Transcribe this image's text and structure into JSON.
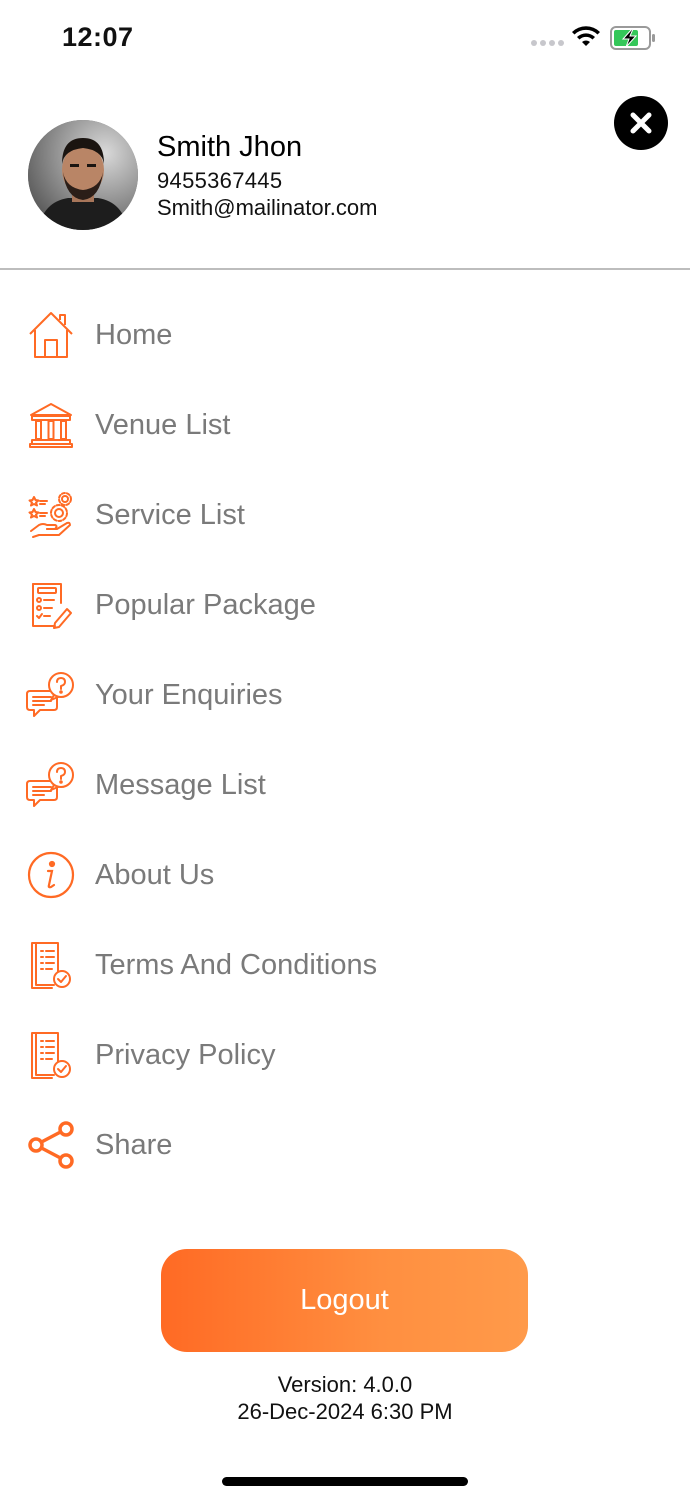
{
  "status_bar": {
    "time": "12:07"
  },
  "profile": {
    "name": "Smith Jhon",
    "phone": "9455367445",
    "email": "Smith@mailinator.com"
  },
  "menu": {
    "items": [
      {
        "label": "Home",
        "icon": "home-icon"
      },
      {
        "label": "Venue List",
        "icon": "venue-building-icon"
      },
      {
        "label": "Service List",
        "icon": "service-hand-gear-icon"
      },
      {
        "label": "Popular Package",
        "icon": "package-checklist-icon"
      },
      {
        "label": "Your Enquiries",
        "icon": "enquiry-chat-icon"
      },
      {
        "label": "Message List",
        "icon": "message-chat-icon"
      },
      {
        "label": "About Us",
        "icon": "info-icon"
      },
      {
        "label": "Terms And Conditions",
        "icon": "document-check-icon"
      },
      {
        "label": "Privacy Policy",
        "icon": "document-check-icon"
      },
      {
        "label": "Share",
        "icon": "share-icon"
      }
    ]
  },
  "logout_label": "Logout",
  "version": "Version: 4.0.0",
  "date": "26-Dec-2024 6:30 PM",
  "colors": {
    "accent": "#ff6a24",
    "menu_text": "#7a7a7a",
    "battery_fill": "#34c759"
  }
}
